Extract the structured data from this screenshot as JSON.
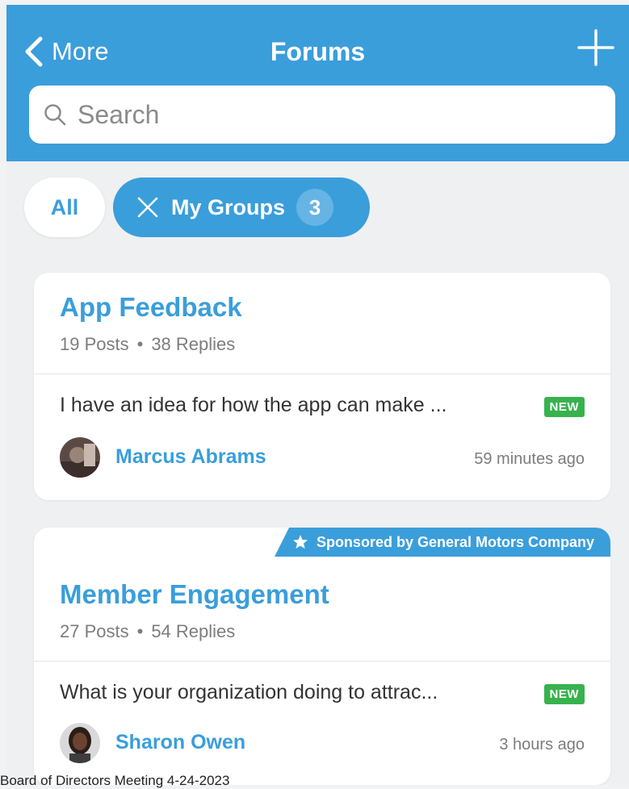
{
  "header": {
    "back_label": "More",
    "title": "Forums"
  },
  "search": {
    "placeholder": "Search"
  },
  "filters": {
    "all_label": "All",
    "my_groups_label": "My Groups",
    "my_groups_count": "3"
  },
  "forums": [
    {
      "title": "App Feedback",
      "posts": "19 Posts",
      "replies": "38 Replies",
      "latest_post": "I have an idea for how the app can make ...",
      "badge": "NEW",
      "author": "Marcus Abrams",
      "time": "59 minutes ago"
    },
    {
      "sponsor": "Sponsored by General Motors Company",
      "title": "Member Engagement",
      "posts": "27 Posts",
      "replies": "54 Replies",
      "latest_post": "What is your organization doing to attrac...",
      "badge": "NEW",
      "author": "Sharon Owen",
      "time": "3 hours ago"
    }
  ],
  "footer_text": "Board of Directors Meeting 4-24-2023",
  "colors": {
    "primary": "#3a9edb",
    "new_badge": "#37b24d",
    "background": "#eff0f2"
  },
  "icons": [
    "chevron-left-icon",
    "plus-icon",
    "search-icon",
    "close-icon",
    "star-icon"
  ]
}
